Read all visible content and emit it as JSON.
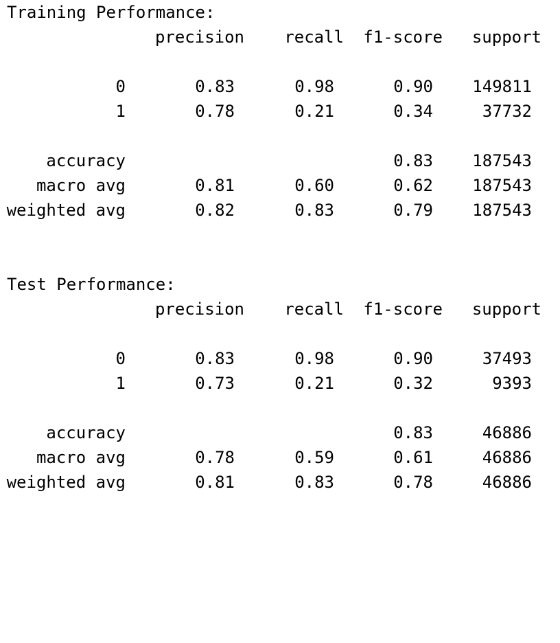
{
  "sections": [
    {
      "title": "Training Performance:",
      "headers": {
        "precision": "precision",
        "recall": "recall",
        "f1": "f1-score",
        "support": "support"
      },
      "rows": [
        {
          "label": "0",
          "precision": "0.83",
          "recall": "0.98",
          "f1": "0.90",
          "support": "149811"
        },
        {
          "label": "1",
          "precision": "0.78",
          "recall": "0.21",
          "f1": "0.34",
          "support": "37732"
        }
      ],
      "summary": [
        {
          "label": "accuracy",
          "precision": "",
          "recall": "",
          "f1": "0.83",
          "support": "187543"
        },
        {
          "label": "macro avg",
          "precision": "0.81",
          "recall": "0.60",
          "f1": "0.62",
          "support": "187543"
        },
        {
          "label": "weighted avg",
          "precision": "0.82",
          "recall": "0.83",
          "f1": "0.79",
          "support": "187543"
        }
      ]
    },
    {
      "title": "Test Performance:",
      "headers": {
        "precision": "precision",
        "recall": "recall",
        "f1": "f1-score",
        "support": "support"
      },
      "rows": [
        {
          "label": "0",
          "precision": "0.83",
          "recall": "0.98",
          "f1": "0.90",
          "support": "37493"
        },
        {
          "label": "1",
          "precision": "0.73",
          "recall": "0.21",
          "f1": "0.32",
          "support": "9393"
        }
      ],
      "summary": [
        {
          "label": "accuracy",
          "precision": "",
          "recall": "",
          "f1": "0.83",
          "support": "46886"
        },
        {
          "label": "macro avg",
          "precision": "0.78",
          "recall": "0.59",
          "f1": "0.61",
          "support": "46886"
        },
        {
          "label": "weighted avg",
          "precision": "0.81",
          "recall": "0.83",
          "f1": "0.78",
          "support": "46886"
        }
      ]
    }
  ]
}
